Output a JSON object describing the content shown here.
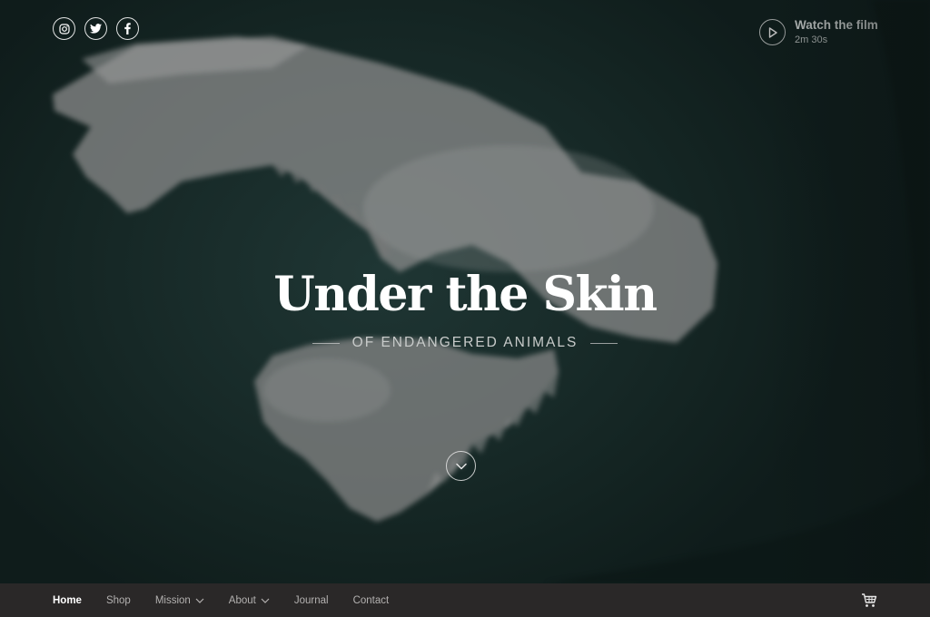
{
  "social": [
    {
      "icon": "instagram-icon"
    },
    {
      "icon": "twitter-icon"
    },
    {
      "icon": "facebook-icon"
    }
  ],
  "watch": {
    "title": "Watch the film",
    "duration": "2m 30s",
    "icon": "play-icon"
  },
  "hero": {
    "title": "Under the Skin",
    "subtitle": "OF ENDANGERED ANIMALS",
    "scroll_icon": "chevron-down-icon"
  },
  "nav": {
    "items": [
      {
        "label": "Home",
        "active": true
      },
      {
        "label": "Shop"
      },
      {
        "label": "Mission",
        "has_dropdown": true
      },
      {
        "label": "About",
        "has_dropdown": true
      },
      {
        "label": "Journal"
      },
      {
        "label": "Contact"
      }
    ],
    "cart_icon": "cart-icon"
  },
  "colors": {
    "background": "#14211f",
    "navbar": "#2a2828",
    "title": "#ffffff",
    "nav_text": "#b3b1b0"
  }
}
